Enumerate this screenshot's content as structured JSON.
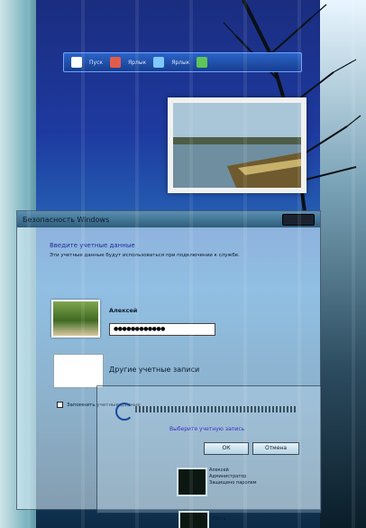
{
  "taskbar": {
    "start_label": "Пуск",
    "item1_label": "Ярлык",
    "item2_label": "Ярлык"
  },
  "dialog": {
    "title": "Безопасность Windows",
    "heading": "Введите учетные данные",
    "subtext": "Эти учетные данные будут использоваться при подключении к службе.",
    "account": {
      "name": "Алексей",
      "password_mask": "●●●●●●●●●●●●"
    },
    "other_accounts_label": "Другие учетные записи",
    "remember_label": "Запомнить учетные данные"
  },
  "subpanel": {
    "link_label": "Выберите учетную запись",
    "ok_label": "ОК",
    "cancel_label": "Отмена"
  },
  "accounts": [
    {
      "label_line1": "Алексей",
      "label_line2": "Администратор",
      "label_line3": "Защищено паролем"
    },
    {
      "label_line1": "Гость"
    }
  ],
  "icons": {
    "start": "windows-logo-icon",
    "user": "user-icon",
    "spinner": "loading-icon"
  }
}
